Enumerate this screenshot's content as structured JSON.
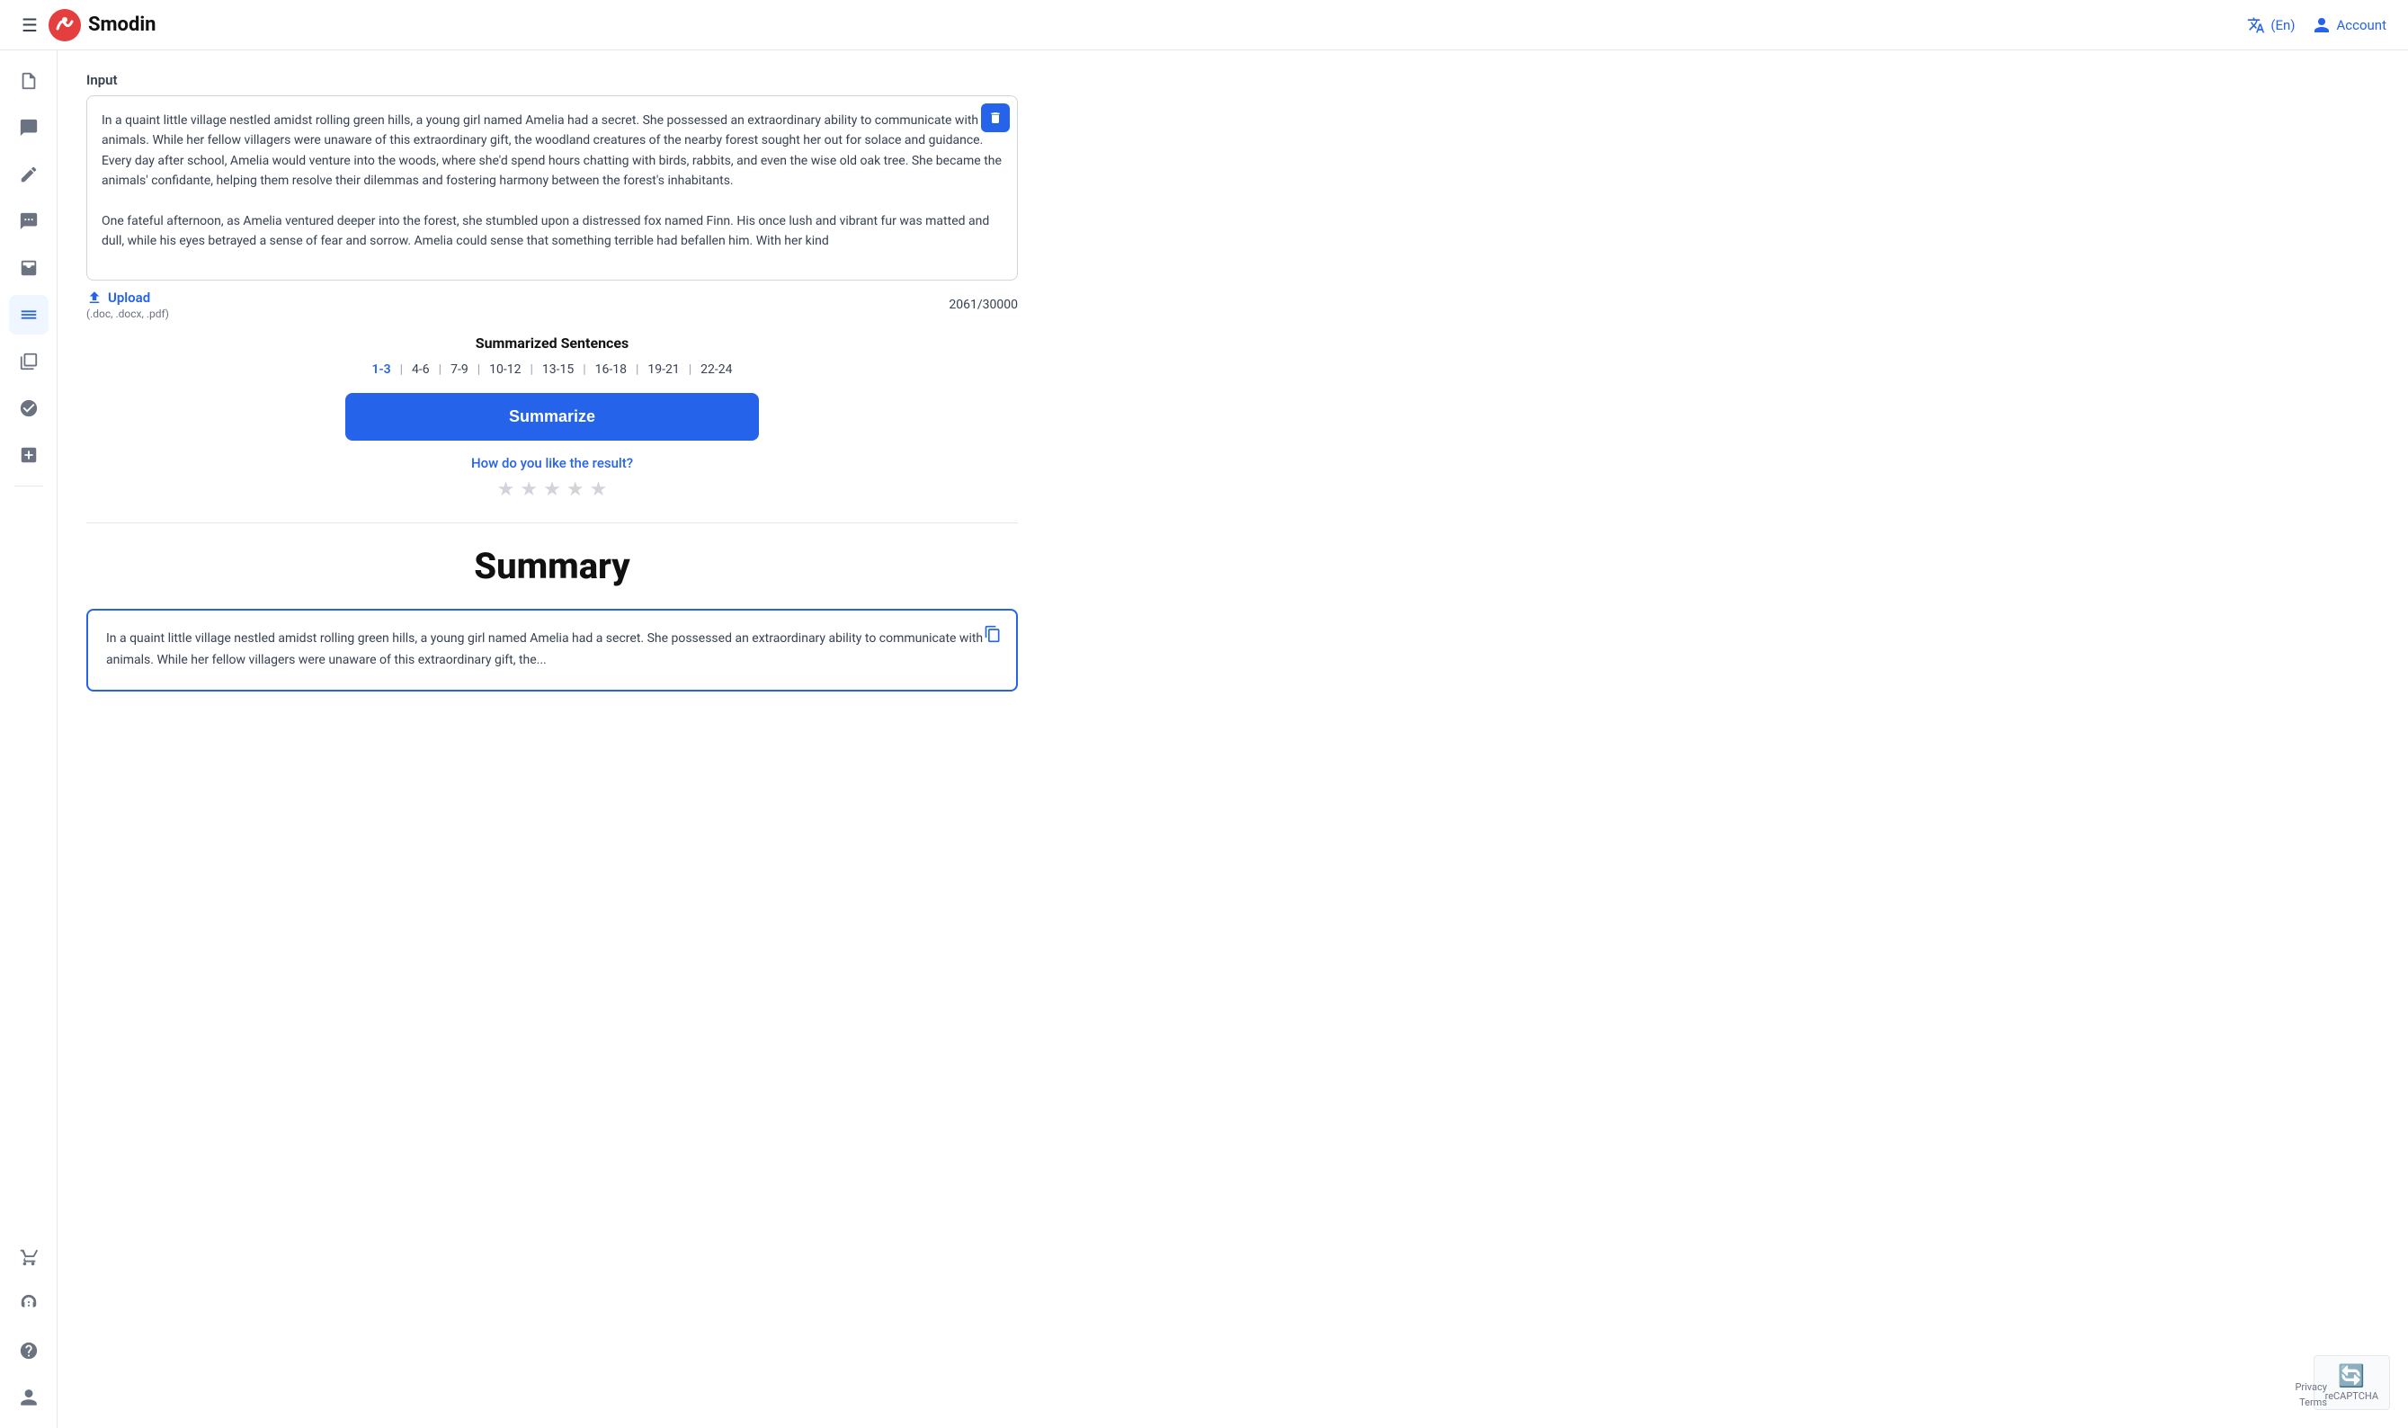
{
  "header": {
    "menu_icon": "☰",
    "logo_text": "Smodin",
    "translate_label": "(En)",
    "account_label": "Account"
  },
  "sidebar": {
    "items": [
      {
        "id": "document",
        "icon": "📄",
        "active": false
      },
      {
        "id": "chat",
        "icon": "💬",
        "active": false
      },
      {
        "id": "edit",
        "icon": "✏️",
        "active": false
      },
      {
        "id": "message",
        "icon": "🗨️",
        "active": false
      },
      {
        "id": "inbox",
        "icon": "📥",
        "active": false
      },
      {
        "id": "text",
        "icon": "≡",
        "active": true
      },
      {
        "id": "grid2",
        "icon": "⊞",
        "active": false
      },
      {
        "id": "letter-a",
        "icon": "A",
        "active": false
      },
      {
        "id": "plus-grid",
        "icon": "⊕",
        "active": false
      }
    ],
    "bottom_items": [
      {
        "id": "cart",
        "icon": "🛒"
      },
      {
        "id": "support",
        "icon": "🎧"
      },
      {
        "id": "help",
        "icon": "❓"
      },
      {
        "id": "user",
        "icon": "👤"
      }
    ]
  },
  "input_section": {
    "label": "Input",
    "text_content": "In a quaint little village nestled amidst rolling green hills, a young girl named Amelia had a secret. She possessed an extraordinary ability to communicate with animals. While her fellow villagers were unaware of this extraordinary gift, the woodland creatures of the nearby forest sought her out for solace and guidance. Every day after school, Amelia would venture into the woods, where she'd spend hours chatting with birds, rabbits, and even the wise old oak tree. She became the animals' confidante, helping them resolve their dilemmas and fostering harmony between the forest's inhabitants.\n\nOne fateful afternoon, as Amelia ventured deeper into the forest, she stumbled upon a distressed fox named Finn. His once lush and vibrant fur was matted and dull, while his eyes betrayed a sense of fear and sorrow. Amelia could sense that something terrible had befallen him. With her kind",
    "char_count": "2061/30000",
    "upload_label": "Upload",
    "upload_formats": "(.doc, .docx, .pdf)"
  },
  "summarize_section": {
    "title": "Summarized Sentences",
    "tabs": [
      {
        "label": "1-3",
        "active": true
      },
      {
        "label": "4-6",
        "active": false
      },
      {
        "label": "7-9",
        "active": false
      },
      {
        "label": "10-12",
        "active": false
      },
      {
        "label": "13-15",
        "active": false
      },
      {
        "label": "16-18",
        "active": false
      },
      {
        "label": "19-21",
        "active": false
      },
      {
        "label": "22-24",
        "active": false
      }
    ],
    "button_label": "Summarize",
    "rating_question": "How do you like the result?",
    "stars": [
      1,
      2,
      3,
      4,
      5
    ]
  },
  "summary_section": {
    "heading": "Summary",
    "text": "In a quaint little village nestled amidst rolling green hills, a young girl named Amelia had a secret. She possessed an extraordinary ability to communicate with animals. While her fellow villagers were unaware of this extraordinary gift, the..."
  },
  "footer": {
    "privacy_label": "Privacy",
    "terms_label": "Terms"
  }
}
